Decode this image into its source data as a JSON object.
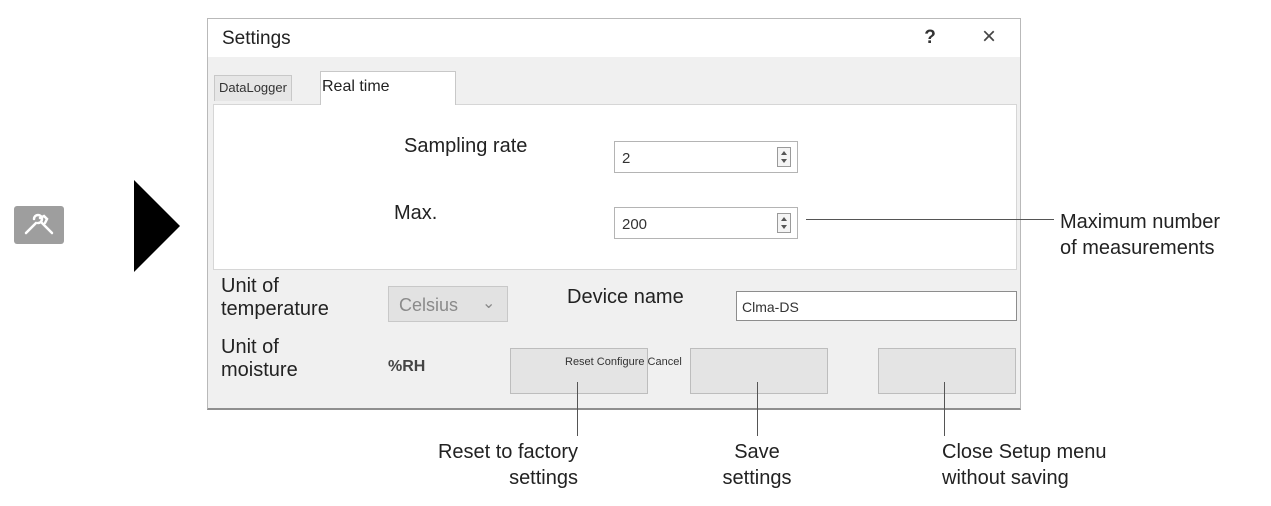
{
  "dialog": {
    "title": "Settings",
    "help_label": "?",
    "close_label": "×"
  },
  "tabs": [
    {
      "label": "DataLogger"
    },
    {
      "label": "Real time"
    }
  ],
  "sampling": {
    "label": "Sampling rate",
    "value": "2"
  },
  "max": {
    "label": "Max.",
    "value": "200"
  },
  "temperature": {
    "label_line1": "Unit of",
    "label_line2": "temperature",
    "selected": "Celsius"
  },
  "device": {
    "label": "Device name",
    "value": "Clma-DS"
  },
  "moisture": {
    "label_line1": "Unit of",
    "label_line2": "moisture",
    "value": "%RH"
  },
  "action_buttons_caption": "Reset Configure Cancel",
  "callouts": {
    "max_line1": "Maximum number",
    "max_line2": "of measurements",
    "reset_line1": "Reset to factory",
    "reset_line2": "settings",
    "save_line1": "Save",
    "save_line2": "settings",
    "close_line1": "Close Setup menu",
    "close_line2": "without saving"
  },
  "icons": {
    "tool": "tools-icon",
    "arrow": "play-arrow-icon",
    "spin": "spinner-arrows-icon",
    "chevron": "chevron-down-icon"
  },
  "colors": {
    "dialog_bg": "#f0f0f0",
    "panel_bg": "#ffffff",
    "button_bg": "#e4e4e4",
    "arrow": "#000000"
  }
}
